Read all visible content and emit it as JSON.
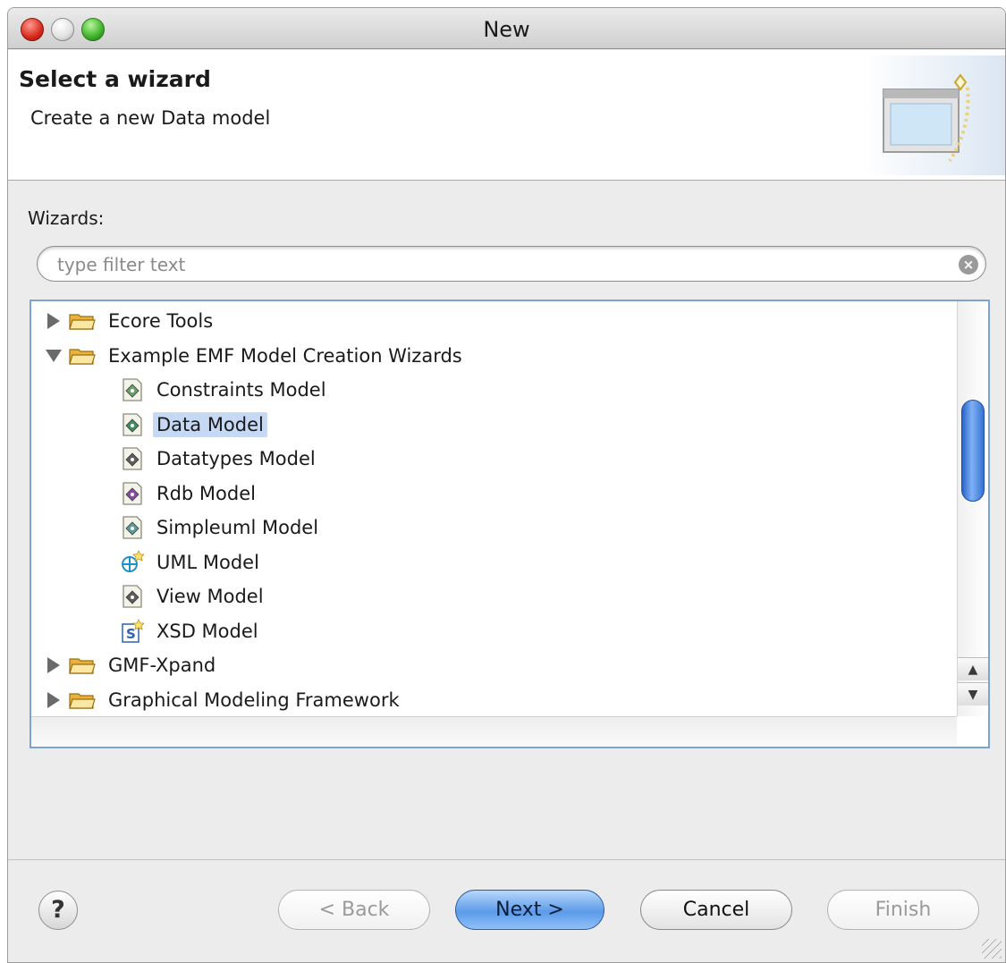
{
  "window": {
    "title": "New"
  },
  "header": {
    "title": "Select a wizard",
    "subtitle": "Create a new Data model",
    "graphic": "new-wizard-graphic"
  },
  "wizards": {
    "label": "Wizards:",
    "filter_placeholder": "type filter text",
    "tree": [
      {
        "label": "Ecore Tools",
        "kind": "folder",
        "expanded": false,
        "level": 0
      },
      {
        "label": "Example EMF Model Creation Wizards",
        "kind": "folder",
        "expanded": true,
        "level": 0
      },
      {
        "label": "Constraints Model",
        "kind": "item",
        "icon": "model-icon",
        "icon_color": "#6aa36a",
        "level": 1
      },
      {
        "label": "Data Model",
        "kind": "item",
        "icon": "model-icon",
        "icon_color": "#3f8f62",
        "level": 1,
        "selected": true
      },
      {
        "label": "Datatypes Model",
        "kind": "item",
        "icon": "model-icon",
        "icon_color": "#5e5e5e",
        "level": 1
      },
      {
        "label": "Rdb Model",
        "kind": "item",
        "icon": "model-icon",
        "icon_color": "#8a4aa5",
        "level": 1
      },
      {
        "label": "Simpleuml Model",
        "kind": "item",
        "icon": "model-icon",
        "icon_color": "#5b9d9d",
        "level": 1
      },
      {
        "label": "UML Model",
        "kind": "item",
        "icon": "uml-model-icon",
        "icon_color": "#1e8fc4",
        "level": 1
      },
      {
        "label": "View Model",
        "kind": "item",
        "icon": "model-icon",
        "icon_color": "#5e5e5e",
        "level": 1
      },
      {
        "label": "XSD Model",
        "kind": "item",
        "icon": "xsd-model-icon",
        "icon_color": "#2c62b0",
        "level": 1
      },
      {
        "label": "GMF-Xpand",
        "kind": "folder",
        "expanded": false,
        "level": 0
      },
      {
        "label": "Graphical Modeling Framework",
        "kind": "folder",
        "expanded": false,
        "level": 0
      }
    ]
  },
  "buttons": {
    "help": "?",
    "back": "< Back",
    "next": "Next >",
    "cancel": "Cancel",
    "finish": "Finish"
  },
  "colors": {
    "selection": "#c5d9f5",
    "accent": "#5b9be9",
    "folder": "#e8b33c"
  }
}
